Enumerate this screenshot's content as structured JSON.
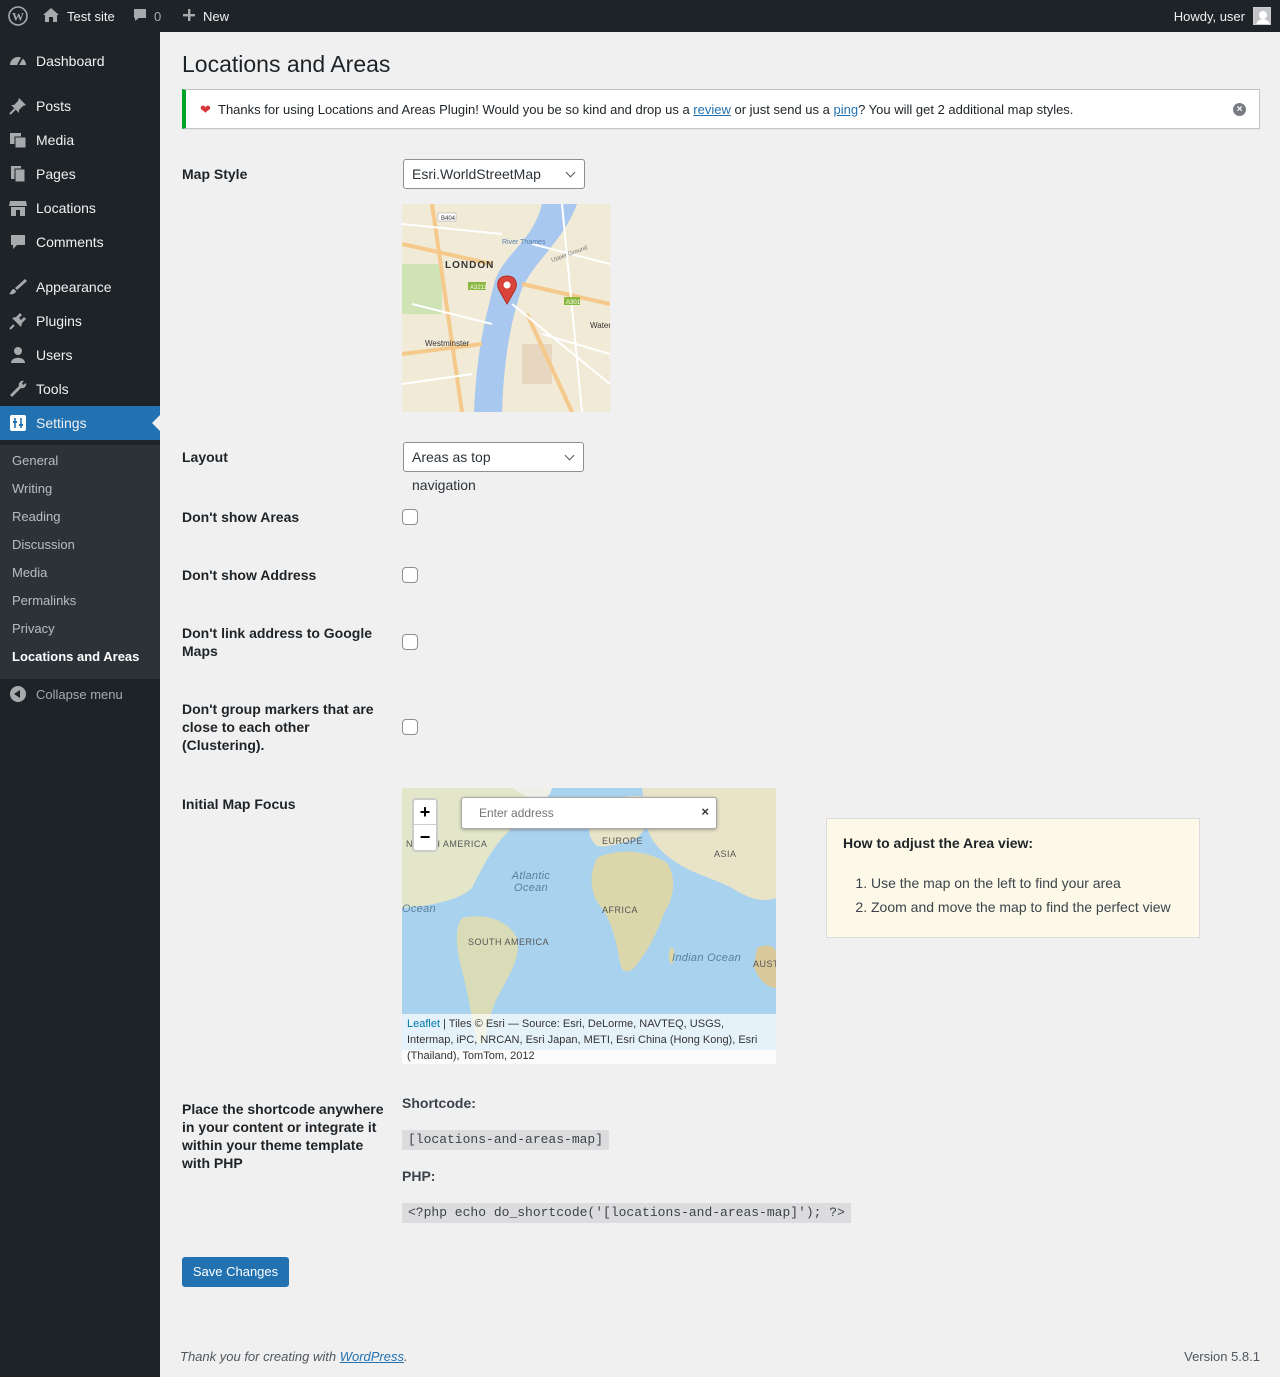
{
  "admin_bar": {
    "site_name": "Test site",
    "comments_count": "0",
    "new_label": "New",
    "howdy": "Howdy, user"
  },
  "sidebar": {
    "items": [
      {
        "label": "Dashboard",
        "icon": "dashboard-icon"
      },
      {
        "label": "Posts",
        "icon": "pin-icon"
      },
      {
        "label": "Media",
        "icon": "media-icon"
      },
      {
        "label": "Pages",
        "icon": "pages-icon"
      },
      {
        "label": "Locations",
        "icon": "store-icon"
      },
      {
        "label": "Comments",
        "icon": "comment-icon"
      },
      {
        "label": "Appearance",
        "icon": "brush-icon"
      },
      {
        "label": "Plugins",
        "icon": "plugin-icon"
      },
      {
        "label": "Users",
        "icon": "user-icon"
      },
      {
        "label": "Tools",
        "icon": "wrench-icon"
      },
      {
        "label": "Settings",
        "icon": "settings-icon",
        "current": true
      }
    ],
    "submenu": [
      "General",
      "Writing",
      "Reading",
      "Discussion",
      "Media",
      "Permalinks",
      "Privacy",
      "Locations and Areas"
    ],
    "collapse_label": "Collapse menu"
  },
  "page": {
    "title": "Locations and Areas",
    "notice": {
      "text_before": "Thanks for using Locations and Areas Plugin! Would you be so kind and drop us a ",
      "link1": "review",
      "text_mid": " or just send us a ",
      "link2": "ping",
      "text_after": "? You will get 2 additional map styles."
    },
    "map_style": {
      "label": "Map Style",
      "value": "Esri.WorldStreetMap"
    },
    "preview_map": {
      "labels": [
        "LONDON",
        "Westminster",
        "River Thames",
        "Waterloo",
        "Upper Ground",
        "A3211",
        "A301",
        "B404"
      ]
    },
    "layout": {
      "label": "Layout",
      "value": "Areas as top navigation"
    },
    "checkboxes": [
      {
        "label": "Don't show Areas",
        "checked": false
      },
      {
        "label": "Don't show Address",
        "checked": false
      },
      {
        "label": "Don't link address to Google Maps",
        "checked": false
      },
      {
        "label": "Don't group markers that are close to each other (Clustering).",
        "checked": false
      }
    ],
    "focus": {
      "label": "Initial Map Focus",
      "zoom_in": "+",
      "zoom_out": "−",
      "address_placeholder": "Enter address",
      "clear": "×",
      "map_labels": [
        "NORTH AMERICA",
        "EUROPE",
        "ASIA",
        "Atlantic Ocean",
        "AFRICA",
        "SOUTH AMERICA",
        "Indian Ocean",
        "AUST",
        "Ocean"
      ],
      "attrib_link": "Leaflet",
      "attrib_text": " | Tiles © Esri — Source: Esri, DeLorme, NAVTEQ, USGS, Intermap, iPC, NRCAN, Esri Japan, METI, Esri China (Hong Kong), Esri (Thailand), TomTom, 2012"
    },
    "howto": {
      "title": "How to adjust the Area view:",
      "steps": [
        "Use the map on the left to find your area",
        "Zoom and move the map to find the perfect view"
      ]
    },
    "shortcode": {
      "label": "Place the shortcode anywhere in your content or integrate it within your theme template with PHP",
      "shortcode_head": "Shortcode:",
      "shortcode_value": "[locations-and-areas-map]",
      "php_head": "PHP:",
      "php_value": "<?php echo do_shortcode('[locations-and-areas-map]'); ?>"
    },
    "save_label": "Save Changes"
  },
  "footer": {
    "thanks_before": "Thank you for creating with ",
    "thanks_link": "WordPress",
    "thanks_after": ".",
    "version": "Version 5.8.1"
  },
  "colors": {
    "accent": "#2271b1",
    "notice_border": "#00a32a",
    "heart": "#d63638",
    "marker": "#d9443a"
  }
}
